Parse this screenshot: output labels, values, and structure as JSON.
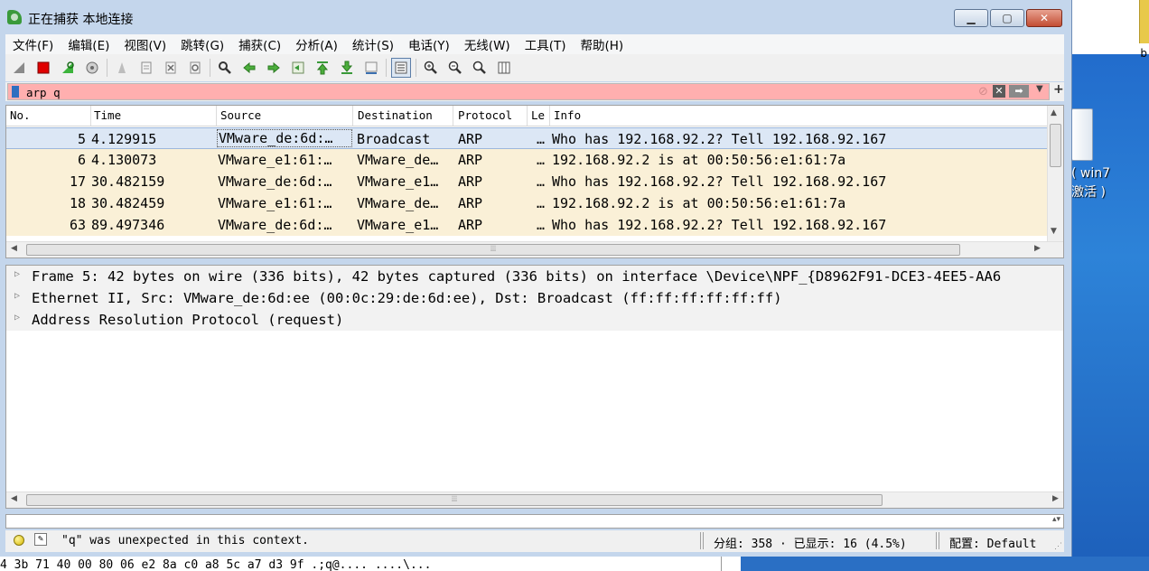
{
  "window": {
    "title": "正在捕获 本地连接"
  },
  "menu": [
    "文件(F)",
    "编辑(E)",
    "视图(V)",
    "跳转(G)",
    "捕获(C)",
    "分析(A)",
    "统计(S)",
    "电话(Y)",
    "无线(W)",
    "工具(T)",
    "帮助(H)"
  ],
  "toolbar": {
    "icons": [
      "shark-fin-start-icon",
      "stop-capture-icon",
      "restart-capture-icon",
      "capture-options-icon",
      "open-file-icon",
      "save-file-icon",
      "close-file-icon",
      "reload-icon",
      "find-packet-icon",
      "go-back-icon",
      "go-forward-icon",
      "go-to-packet-icon",
      "first-packet-icon",
      "last-packet-icon",
      "auto-scroll-icon",
      "colorize-icon",
      "zoom-in-icon",
      "zoom-out-icon",
      "normal-size-icon",
      "resize-columns-icon"
    ]
  },
  "filter": {
    "value": "arp q"
  },
  "packet_list": {
    "columns": [
      "No.",
      "Time",
      "Source",
      "Destination",
      "Protocol",
      "Le",
      "Info"
    ],
    "rows": [
      {
        "no": "5",
        "time": "4.129915",
        "source": "VMware_de:6d:…",
        "destination": "Broadcast",
        "protocol": "ARP",
        "length": "…",
        "info": "Who has 192.168.92.2? Tell 192.168.92.167",
        "selected": true
      },
      {
        "no": "6",
        "time": "4.130073",
        "source": "VMware_e1:61:…",
        "destination": "VMware_de…",
        "protocol": "ARP",
        "length": "…",
        "info": "192.168.92.2 is at 00:50:56:e1:61:7a",
        "selected": false
      },
      {
        "no": "17",
        "time": "30.482159",
        "source": "VMware_de:6d:…",
        "destination": "VMware_e1…",
        "protocol": "ARP",
        "length": "…",
        "info": "Who has 192.168.92.2? Tell 192.168.92.167",
        "selected": false
      },
      {
        "no": "18",
        "time": "30.482459",
        "source": "VMware_e1:61:…",
        "destination": "VMware_de…",
        "protocol": "ARP",
        "length": "…",
        "info": "192.168.92.2 is at 00:50:56:e1:61:7a",
        "selected": false
      },
      {
        "no": "63",
        "time": "89.497346",
        "source": "VMware_de:6d:…",
        "destination": "VMware_e1…",
        "protocol": "ARP",
        "length": "…",
        "info": "Who has 192.168.92.2? Tell 192.168.92.167",
        "selected": false
      }
    ],
    "row_colors": {
      "arp": "#faf0d7",
      "selected": "#dce7f5"
    }
  },
  "details": [
    "Frame 5: 42 bytes on wire (336 bits), 42 bytes captured (336 bits) on interface \\Device\\NPF_{D8962F91-DCE3-4EE5-AA6",
    "Ethernet II, Src: VMware_de:6d:ee (00:0c:29:de:6d:ee), Dst: Broadcast (ff:ff:ff:ff:ff:ff)",
    "Address Resolution Protocol (request)"
  ],
  "status": {
    "message": "\"q\" was unexpected in this context.",
    "packets": "分组: 358 · 已显示: 16 (4.5%)",
    "profile": "配置: Default"
  },
  "desktop": {
    "label_line1": "( win7",
    "label_line2": "激活 )",
    "corner_letter": "b"
  },
  "background_text": "4 3b 71 40 00 80 06  e2 8a c0 a8 5c a7 d3 9f  .;q@.... ....\\..."
}
